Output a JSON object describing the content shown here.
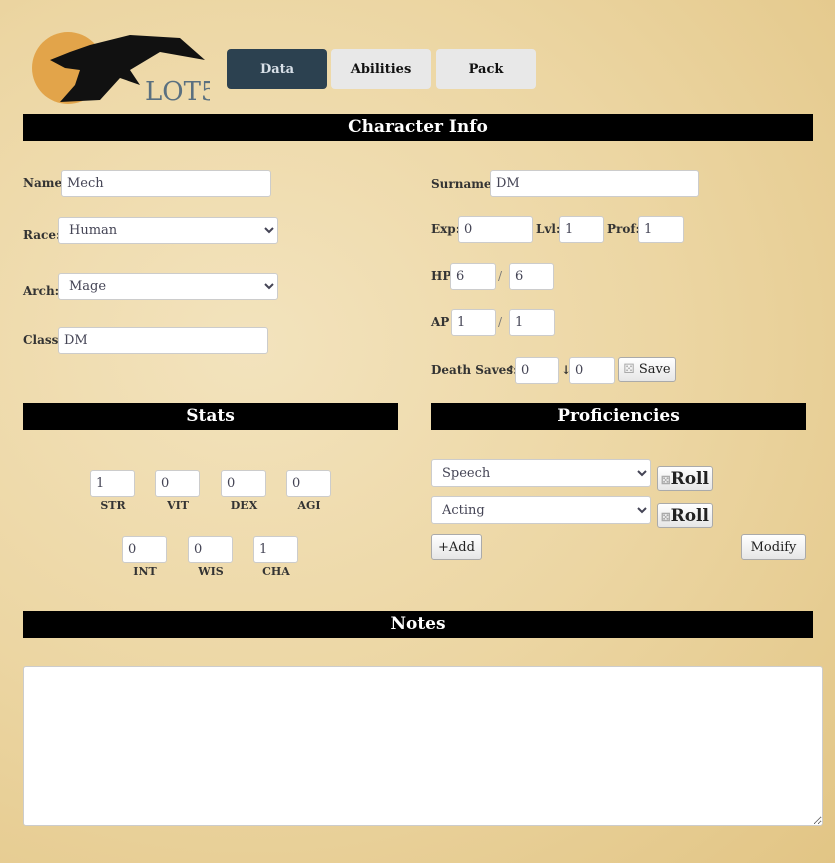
{
  "logo": {
    "text": "LOT5",
    "accent": "#e2a44a"
  },
  "tabs": [
    {
      "label": "Data"
    },
    {
      "label": "Abilities"
    },
    {
      "label": "Pack"
    }
  ],
  "sections": {
    "character_info": "Character Info",
    "stats": "Stats",
    "proficiencies": "Proficiencies",
    "notes": "Notes"
  },
  "info": {
    "name_label": "Name:",
    "name": "Mech",
    "race_label": "Race:",
    "race": "Human",
    "arch_label": "Arch:",
    "arch": "Mage",
    "class_label": "Class:",
    "class": "DM",
    "surname_label": "Surname:",
    "surname": "DM",
    "exp_label": "Exp:",
    "exp": "0",
    "lvl_label": "Lvl:",
    "lvl": "1",
    "prof_label": "Prof:",
    "prof": "1",
    "hp_label": "HP",
    "hp": "6",
    "hp_max": "6",
    "ap_label": "AP",
    "ap": "1",
    "ap_max": "1",
    "slash": "/",
    "death_label": "Death Saves:",
    "death_up_icon": "↑",
    "death_up": "0",
    "death_down_icon": "↓",
    "death_down": "0",
    "save_label": "Save"
  },
  "stats": [
    {
      "label": "STR",
      "value": "1"
    },
    {
      "label": "VIT",
      "value": "0"
    },
    {
      "label": "DEX",
      "value": "0"
    },
    {
      "label": "AGI",
      "value": "0"
    },
    {
      "label": "INT",
      "value": "0"
    },
    {
      "label": "WIS",
      "value": "0"
    },
    {
      "label": "CHA",
      "value": "1"
    }
  ],
  "proficiencies": {
    "items": [
      {
        "value": "Speech"
      },
      {
        "value": "Acting"
      }
    ],
    "roll_label": "Roll",
    "add_label": "+Add",
    "modify_label": "Modify"
  },
  "notes": {
    "value": ""
  }
}
